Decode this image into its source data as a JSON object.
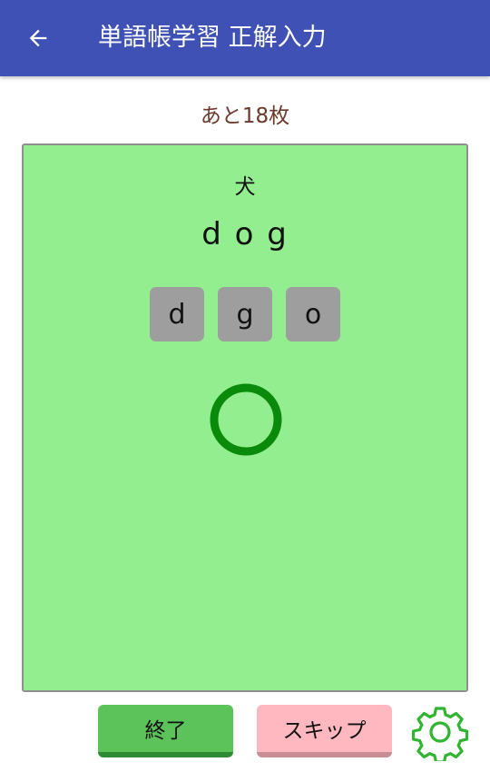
{
  "app_bar": {
    "title": "単語帳学習 正解入力",
    "back_icon": "arrow-left-icon",
    "background": "#3f51b5"
  },
  "progress": {
    "remaining_text": "あと18枚"
  },
  "card": {
    "background": "#93ee8f",
    "meaning": "犬",
    "answer": "d o g",
    "tiles": [
      "d",
      "g",
      "o"
    ],
    "result_icon": "correct-circle-icon",
    "result_color": "#0a8a0a"
  },
  "footer": {
    "end_label": "終了",
    "skip_label": "スキップ",
    "settings_icon": "gear-icon",
    "settings_color": "#2fb52f"
  }
}
